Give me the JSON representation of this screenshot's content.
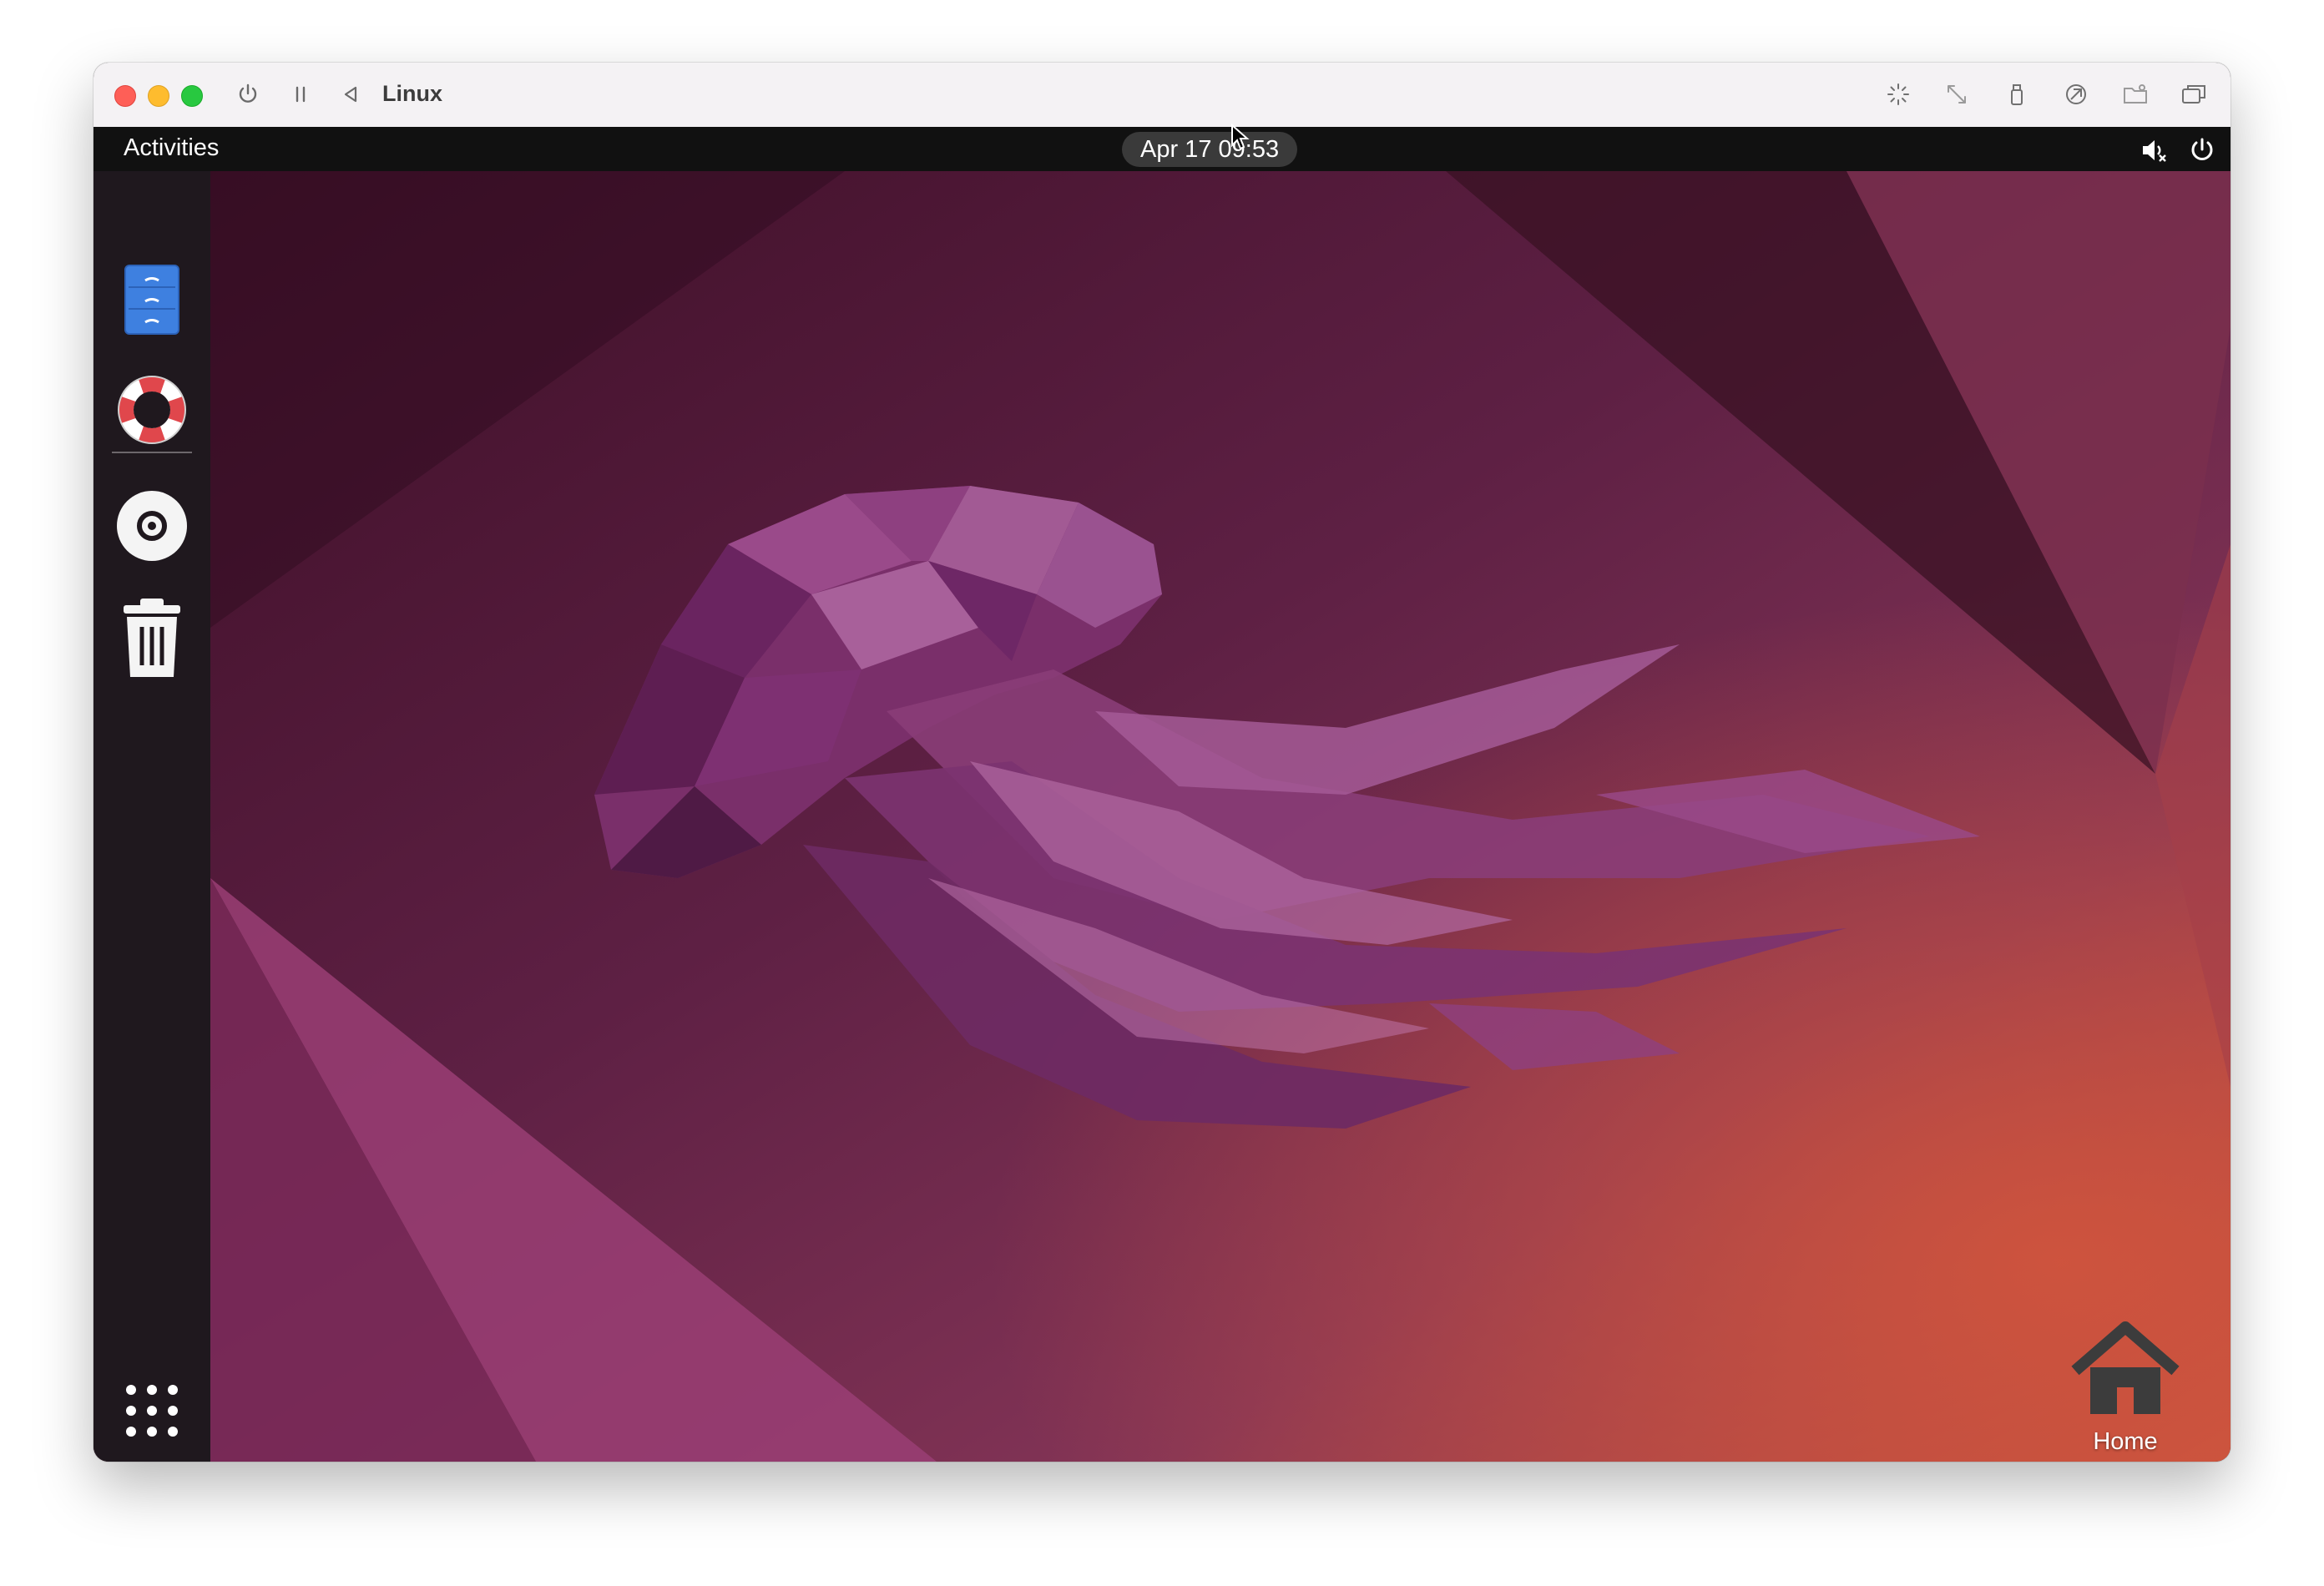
{
  "vm_window": {
    "title": "Linux"
  },
  "topbar": {
    "activities_label": "Activities",
    "clock": "Apr 17  09:53"
  },
  "dock": {
    "items": [
      {
        "name": "Files",
        "icon": "files-icon"
      },
      {
        "name": "Help",
        "icon": "lifebuoy-icon"
      },
      {
        "name": "Disc",
        "icon": "optical-disc-icon"
      },
      {
        "name": "Trash",
        "icon": "trash-icon"
      }
    ],
    "show_apps_icon": "app-grid-icon"
  },
  "desktop": {
    "home_label": "Home"
  },
  "colors": {
    "traffic_close": "#fe5f57",
    "traffic_min": "#febc2e",
    "traffic_max": "#28c840",
    "topbar": "#111111",
    "dock": "#1f181e",
    "files_blue": "#3e80e0"
  }
}
